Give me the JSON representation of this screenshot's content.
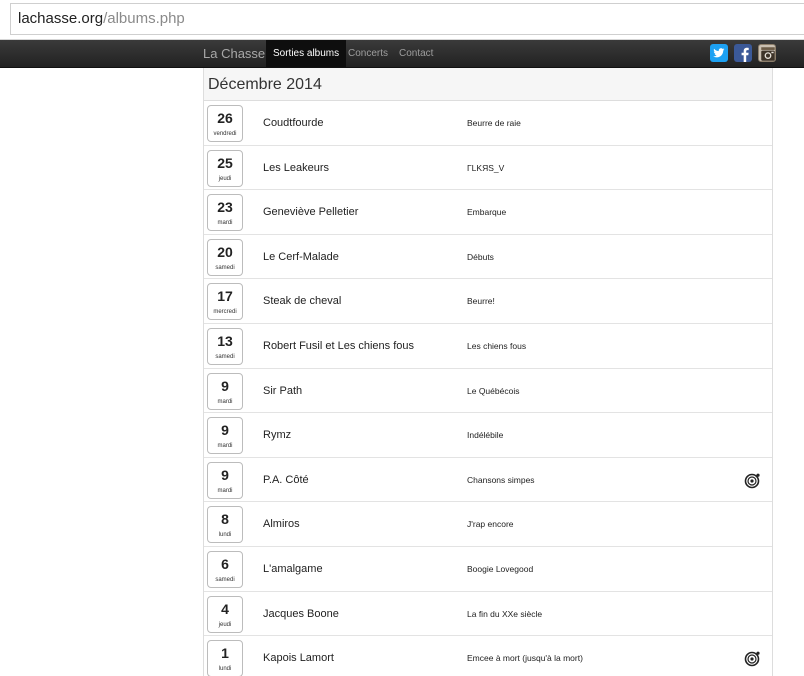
{
  "browser": {
    "url_domain": "lachasse.org",
    "url_path": "/albums.php"
  },
  "nav": {
    "brand": "La Chasse",
    "links": [
      {
        "label": "Sorties albums",
        "active": true
      },
      {
        "label": "Concerts",
        "active": false
      },
      {
        "label": "Contact",
        "active": false
      }
    ],
    "social": [
      "twitter-icon",
      "facebook-icon",
      "instagram-icon"
    ]
  },
  "month": "Décembre 2014",
  "rows": [
    {
      "day": "26",
      "weekday": "vendredi",
      "artist": "Coudtfourde",
      "album": "Beurre de raie",
      "vinyl": false
    },
    {
      "day": "25",
      "weekday": "jeudi",
      "artist": "Les Leakeurs",
      "album": "ΓLKЯS_V",
      "vinyl": false
    },
    {
      "day": "23",
      "weekday": "mardi",
      "artist": "Geneviève Pelletier",
      "album": "Embarque",
      "vinyl": false
    },
    {
      "day": "20",
      "weekday": "samedi",
      "artist": "Le Cerf-Malade",
      "album": "Débuts",
      "vinyl": false
    },
    {
      "day": "17",
      "weekday": "mercredi",
      "artist": "Steak de cheval",
      "album": "Beurre!",
      "vinyl": false
    },
    {
      "day": "13",
      "weekday": "samedi",
      "artist": "Robert Fusil et Les chiens fous",
      "album": "Les chiens fous",
      "vinyl": false
    },
    {
      "day": "9",
      "weekday": "mardi",
      "artist": "Sir Path",
      "album": "Le Québécois",
      "vinyl": false
    },
    {
      "day": "9",
      "weekday": "mardi",
      "artist": "Rymz",
      "album": "Indélébile",
      "vinyl": false
    },
    {
      "day": "9",
      "weekday": "mardi",
      "artist": "P.A. Côté",
      "album": "Chansons simpes",
      "vinyl": true
    },
    {
      "day": "8",
      "weekday": "lundi",
      "artist": "Almiros",
      "album": "J'rap encore",
      "vinyl": false
    },
    {
      "day": "6",
      "weekday": "samedi",
      "artist": "L'amalgame",
      "album": "Boogie Lovegood",
      "vinyl": false
    },
    {
      "day": "4",
      "weekday": "jeudi",
      "artist": "Jacques Boone",
      "album": "La fin du XXe siècle",
      "vinyl": false
    },
    {
      "day": "1",
      "weekday": "lundi",
      "artist": "Kapois Lamort",
      "album": "Emcee à mort (jusqu'à la mort)",
      "vinyl": true
    }
  ]
}
